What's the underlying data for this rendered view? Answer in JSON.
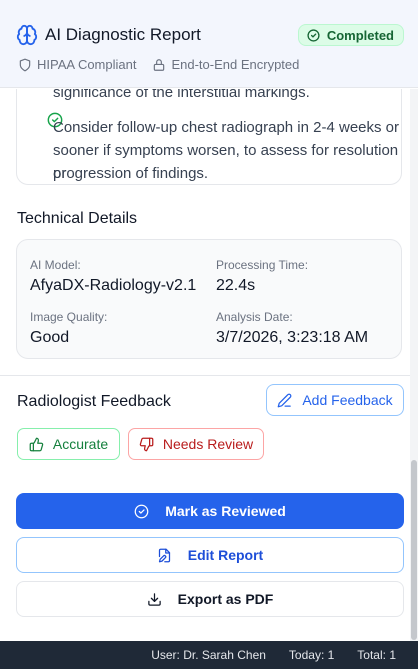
{
  "header": {
    "title": "AI Diagnostic Report",
    "status_badge": "Completed",
    "meta": [
      "HIPAA Compliant",
      "End-to-End Encrypted"
    ]
  },
  "recommendations": {
    "partial_line": "significance of the interstitial markings.",
    "item_lines": [
      "Consider follow-up chest radiograph in 2-4 weeks or",
      "sooner if symptoms worsen, to assess for resolution or",
      "progression of findings."
    ]
  },
  "technical": {
    "heading": "Technical Details",
    "ai_model_label": "AI Model:",
    "ai_model_value": "AfyaDX-Radiology-v2.1",
    "processing_label": "Processing Time:",
    "processing_value": "22.4s",
    "quality_label": "Image Quality:",
    "quality_value": "Good",
    "date_label": "Analysis Date:",
    "date_value": "3/7/2026, 3:23:18 AM"
  },
  "feedback": {
    "heading": "Radiologist Feedback",
    "add_label": "Add Feedback",
    "accurate_label": "Accurate",
    "needs_review_label": "Needs Review"
  },
  "actions": {
    "mark_reviewed": "Mark as Reviewed",
    "edit_report": "Edit Report",
    "export_pdf": "Export as PDF"
  },
  "status_bar": {
    "user": "User: Dr. Sarah Chen",
    "today": "Today: 1",
    "total": "Total: 1"
  },
  "colors": {
    "primary": "#2563eb",
    "success": "#16a34a",
    "danger": "#dc2626",
    "status_bar_bg": "#1f2937"
  },
  "icons": {
    "title": "brain-icon",
    "badge": "check-circle-icon",
    "hipaa": "shield-icon",
    "encrypted": "lock-icon",
    "add_feedback": "pen-icon",
    "accurate": "thumbs-up-icon",
    "needs_review": "thumbs-down-icon",
    "mark_reviewed": "check-circle-icon",
    "edit_report": "file-edit-icon",
    "export": "download-icon"
  }
}
